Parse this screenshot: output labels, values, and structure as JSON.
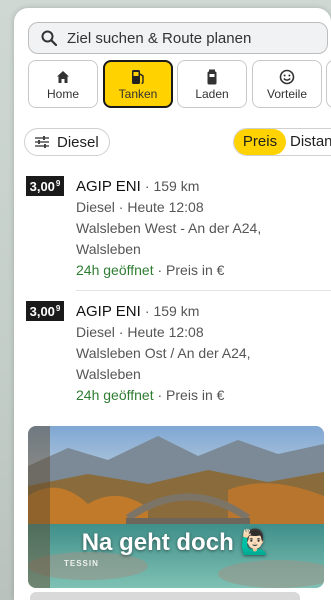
{
  "search": {
    "placeholder": "Ziel suchen & Route planen"
  },
  "categories": [
    {
      "label": "Home",
      "icon": "home-icon",
      "active": false
    },
    {
      "label": "Tanken",
      "icon": "fuel-icon",
      "active": true
    },
    {
      "label": "Laden",
      "icon": "charging-icon",
      "active": false
    },
    {
      "label": "Vorteile",
      "icon": "smiley-icon",
      "active": false
    }
  ],
  "filters": {
    "fuel_type": "Diesel",
    "sort_options": [
      "Preis",
      "Distanz"
    ],
    "sort_selected": "Preis"
  },
  "stations": [
    {
      "price_main": "3,00",
      "price_sup": "9",
      "brand": "AGIP ENI",
      "distance": "159 km",
      "fuel_time": "Diesel · Heute 12:08",
      "address_line1": "Walsleben West - An der A24,",
      "address_line2": "Walsleben",
      "open_status": "24h geöffnet",
      "price_note": "· Preis in €"
    },
    {
      "price_main": "3,00",
      "price_sup": "9",
      "brand": "AGIP ENI",
      "distance": "159 km",
      "fuel_time": "Diesel · Heute 12:08",
      "address_line1": "Walsleben Ost / An der A24,",
      "address_line2": "Walsleben",
      "open_status": "24h geöffnet",
      "price_note": "· Preis in €"
    }
  ],
  "ad": {
    "caption": "Na geht doch 🙋🏻‍♂️",
    "logo": "TESSIN"
  },
  "colors": {
    "accent": "#ffd200",
    "open_green": "#2e7d32",
    "price_tag_bg": "#1a1a1a"
  }
}
